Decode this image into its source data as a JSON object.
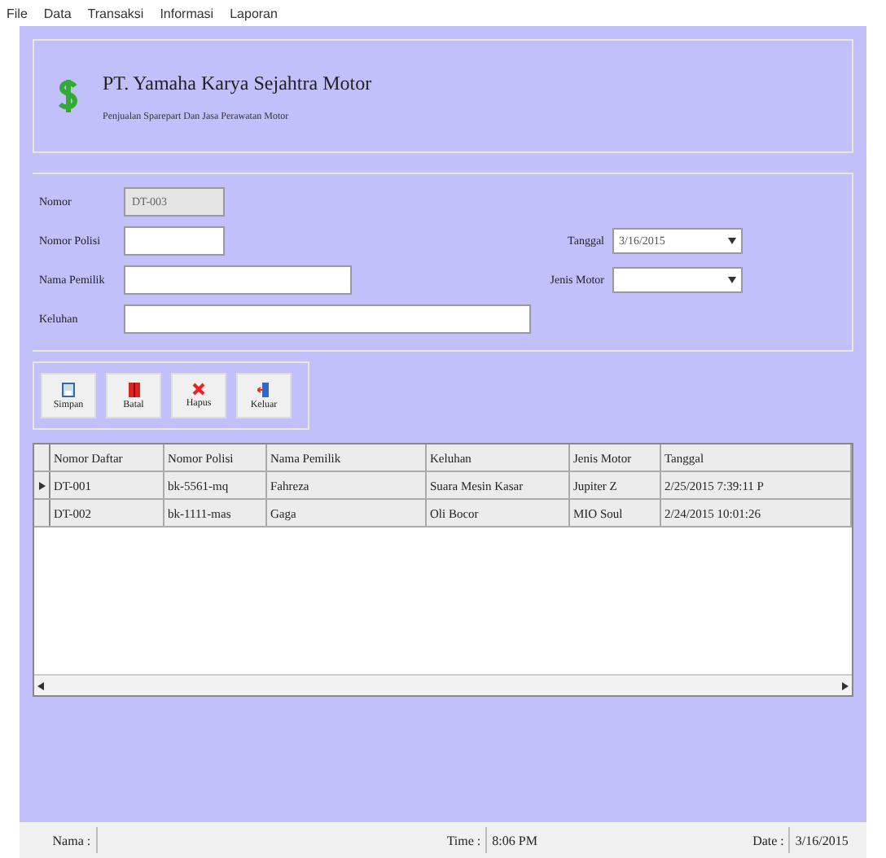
{
  "menu": [
    "File",
    "Data",
    "Transaksi",
    "Informasi",
    "Laporan"
  ],
  "header": {
    "title": "PT. Yamaha Karya Sejahtra Motor",
    "subtitle": "Penjualan Sparepart Dan Jasa Perawatan Motor"
  },
  "form": {
    "nomor": {
      "label": "Nomor",
      "value": "DT-003"
    },
    "nomor_polisi": {
      "label": "Nomor Polisi"
    },
    "nama_pemilik": {
      "label": "Nama Pemilik"
    },
    "keluhan": {
      "label": "Keluhan"
    },
    "tanggal": {
      "label": "Tanggal",
      "value": "3/16/2015"
    },
    "jenis_motor": {
      "label": "Jenis Motor"
    }
  },
  "buttons": [
    {
      "label": "Simpan",
      "kind": "save"
    },
    {
      "label": "Batal",
      "kind": "cancel"
    },
    {
      "label": "Hapus",
      "kind": "delete"
    },
    {
      "label": "Keluar",
      "kind": "exit"
    }
  ],
  "table": {
    "columns": [
      "Nomor Daftar",
      "Nomor Polisi",
      "Nama Pemilik",
      "Keluhan",
      "Jenis Motor",
      "Tanggal"
    ],
    "rows": [
      {
        "selected": true,
        "cells": [
          "DT-001",
          "bk-5561-mq",
          "Fahreza",
          "Suara Mesin Kasar",
          "Jupiter Z",
          "2/25/2015 7:39:11 P"
        ]
      },
      {
        "selected": false,
        "cells": [
          "DT-002",
          "bk-1111-mas",
          "Gaga",
          "Oli Bocor",
          "MIO Soul",
          "2/24/2015 10:01:26"
        ]
      }
    ]
  },
  "status_bar": {
    "name_label": "Nama :",
    "time_label": "Time :",
    "time": "8:06 PM",
    "date_label": "Date :",
    "date": "3/16/2015"
  }
}
